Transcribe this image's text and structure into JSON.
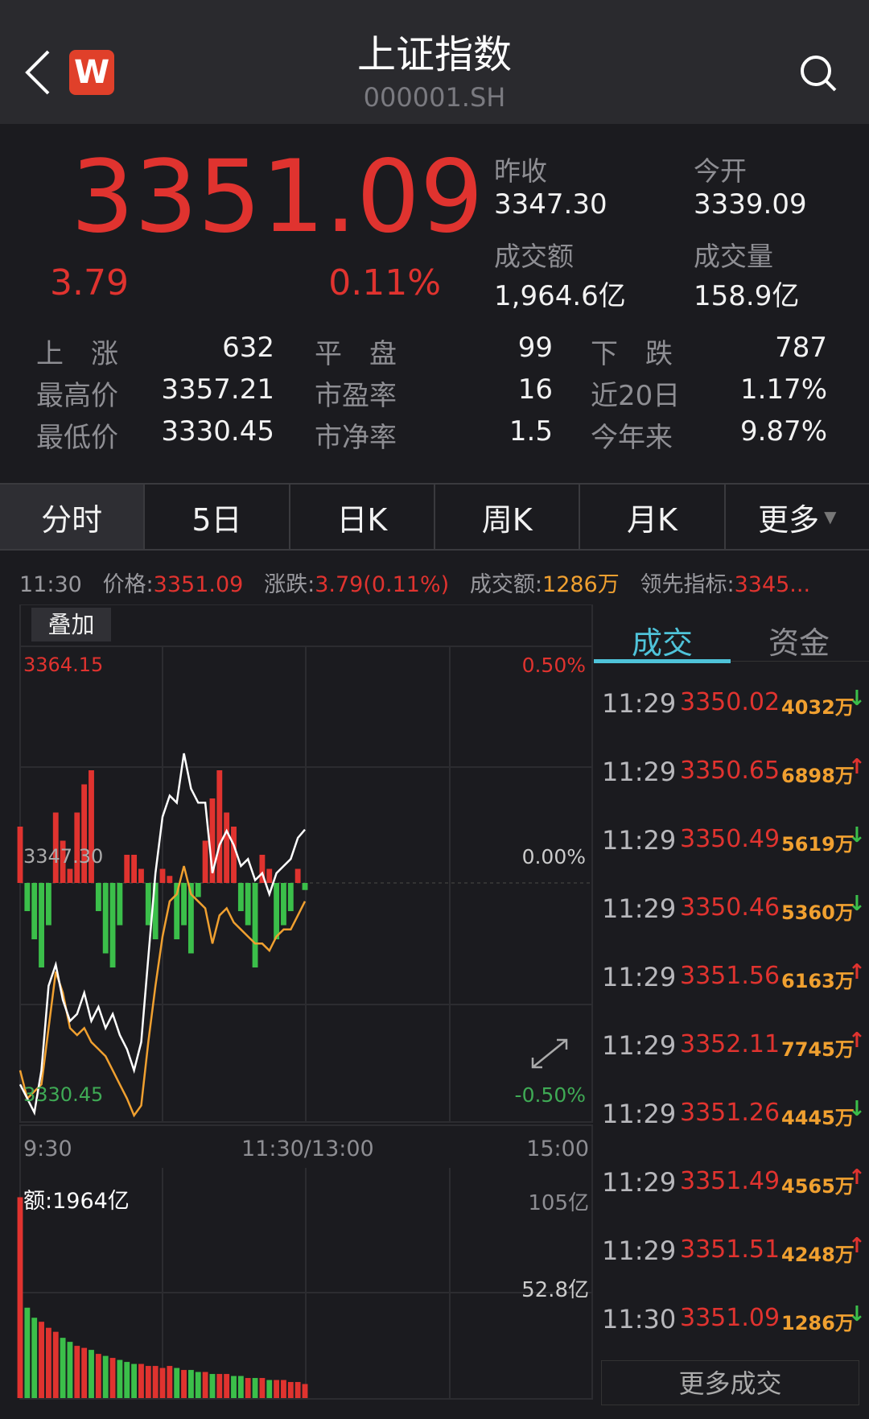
{
  "header": {
    "title": "上证指数",
    "code": "000001.SH",
    "logo_letter": "W",
    "back_icon": "chevron-left",
    "search_icon": "search"
  },
  "quote": {
    "price": "3351.09",
    "change": "3.79",
    "change_pct": "0.11%",
    "prev_close_label": "昨收",
    "prev_close": "3347.30",
    "open_label": "今开",
    "open": "3339.09",
    "turnover_label": "成交额",
    "turnover": "1,964.6亿",
    "volume_label": "成交量",
    "volume": "158.9亿"
  },
  "stats": [
    [
      {
        "label": "上　涨",
        "value": "632"
      },
      {
        "label": "平　盘",
        "value": "99"
      },
      {
        "label": "下　跌",
        "value": "787"
      }
    ],
    [
      {
        "label": "最高价",
        "value": "3357.21"
      },
      {
        "label": "市盈率",
        "value": "16"
      },
      {
        "label": "近20日",
        "value": "1.17%"
      }
    ],
    [
      {
        "label": "最低价",
        "value": "3330.45"
      },
      {
        "label": "市净率",
        "value": "1.5"
      },
      {
        "label": "今年来",
        "value": "9.87%"
      }
    ]
  ],
  "tabs": [
    "分时",
    "5日",
    "日K",
    "周K",
    "月K",
    "更多"
  ],
  "info_line": {
    "time": "11:30",
    "price_label": "价格:",
    "price": "3351.09",
    "chg_label": "涨跌:",
    "chg": "3.79(0.11%)",
    "amt_label": "成交额:",
    "amt": "1286万",
    "lead_label": "领先指标:",
    "lead": "3345..."
  },
  "chart": {
    "overlay_button": "叠加",
    "y_top": "3364.15",
    "y_mid": "3347.30",
    "y_bottom": "3330.45",
    "pct_top": "0.50%",
    "pct_mid": "0.00%",
    "pct_bottom": "-0.50%",
    "x_labels": [
      "9:30",
      "11:30/13:00",
      "15:00"
    ],
    "amount_label": "额:1964亿",
    "vol_top": "105亿",
    "vol_mid": "52.8亿",
    "colors": {
      "up": "#e0332f",
      "down": "#3bbf4a",
      "price": "#ffffff",
      "avg": "#f0a030"
    }
  },
  "chart_data": {
    "type": "line",
    "x_unit": "minutes since 9:30",
    "step": 3,
    "prev_close": 3347.3,
    "ylim": [
      3330.45,
      3364.15
    ],
    "price": [
      3333,
      3332,
      3331,
      3334,
      3340,
      3341.5,
      3339,
      3337.5,
      3338,
      3339.5,
      3337.5,
      3338.5,
      3337,
      3338,
      3336.5,
      3335.5,
      3334,
      3336,
      3342,
      3348,
      3352,
      3353.5,
      3353,
      3356.5,
      3354,
      3353,
      3353,
      3348,
      3350,
      3351,
      3350,
      3348.5,
      3349,
      3347.5,
      3348,
      3346.5,
      3348,
      3348.5,
      3349,
      3350.5,
      3351.09
    ],
    "avg": [
      3334,
      3332,
      3332.5,
      3333,
      3337,
      3341,
      3339.5,
      3337,
      3336.5,
      3337,
      3336,
      3335.5,
      3335,
      3334,
      3333,
      3332,
      3330.8,
      3331.5,
      3336,
      3340,
      3343.5,
      3346,
      3346.5,
      3348.5,
      3346.5,
      3346,
      3345.5,
      3343,
      3345,
      3345.5,
      3344.5,
      3344,
      3343.5,
      3343,
      3343,
      3342.5,
      3343.5,
      3344,
      3344,
      3345,
      3346
    ],
    "lead_bars": [
      4,
      -2,
      -4,
      -6,
      -3,
      5,
      3,
      1,
      5,
      7,
      8,
      -2,
      -5,
      -6,
      -3,
      2,
      2,
      1,
      -3,
      -4,
      1,
      0.5,
      -4,
      -3,
      -5,
      -1,
      3,
      6,
      8,
      5,
      4,
      -2,
      -3,
      -6,
      2,
      1,
      -4,
      -3,
      -2,
      1,
      -0.5
    ],
    "volume": [
      100,
      45,
      40,
      38,
      35,
      33,
      30,
      28,
      26,
      25,
      24,
      22,
      21,
      20,
      19,
      18,
      17,
      17,
      16,
      16,
      15,
      16,
      15,
      14,
      14,
      13,
      13,
      12,
      12,
      12,
      11,
      11,
      10,
      10,
      10,
      9,
      9,
      9,
      8,
      8,
      7
    ]
  },
  "trades_panel": {
    "tabs": [
      "成交",
      "资金"
    ],
    "more_button": "更多成交",
    "rows": [
      {
        "time": "11:29",
        "price": "3350.02",
        "vol": "4032万",
        "dir": "down"
      },
      {
        "time": "11:29",
        "price": "3350.65",
        "vol": "6898万",
        "dir": "up"
      },
      {
        "time": "11:29",
        "price": "3350.49",
        "vol": "5619万",
        "dir": "down"
      },
      {
        "time": "11:29",
        "price": "3350.46",
        "vol": "5360万",
        "dir": "down"
      },
      {
        "time": "11:29",
        "price": "3351.56",
        "vol": "6163万",
        "dir": "up"
      },
      {
        "time": "11:29",
        "price": "3352.11",
        "vol": "7745万",
        "dir": "up"
      },
      {
        "time": "11:29",
        "price": "3351.26",
        "vol": "4445万",
        "dir": "down"
      },
      {
        "time": "11:29",
        "price": "3351.49",
        "vol": "4565万",
        "dir": "up"
      },
      {
        "time": "11:29",
        "price": "3351.51",
        "vol": "4248万",
        "dir": "up"
      },
      {
        "time": "11:30",
        "price": "3351.09",
        "vol": "1286万",
        "dir": "down"
      }
    ]
  }
}
